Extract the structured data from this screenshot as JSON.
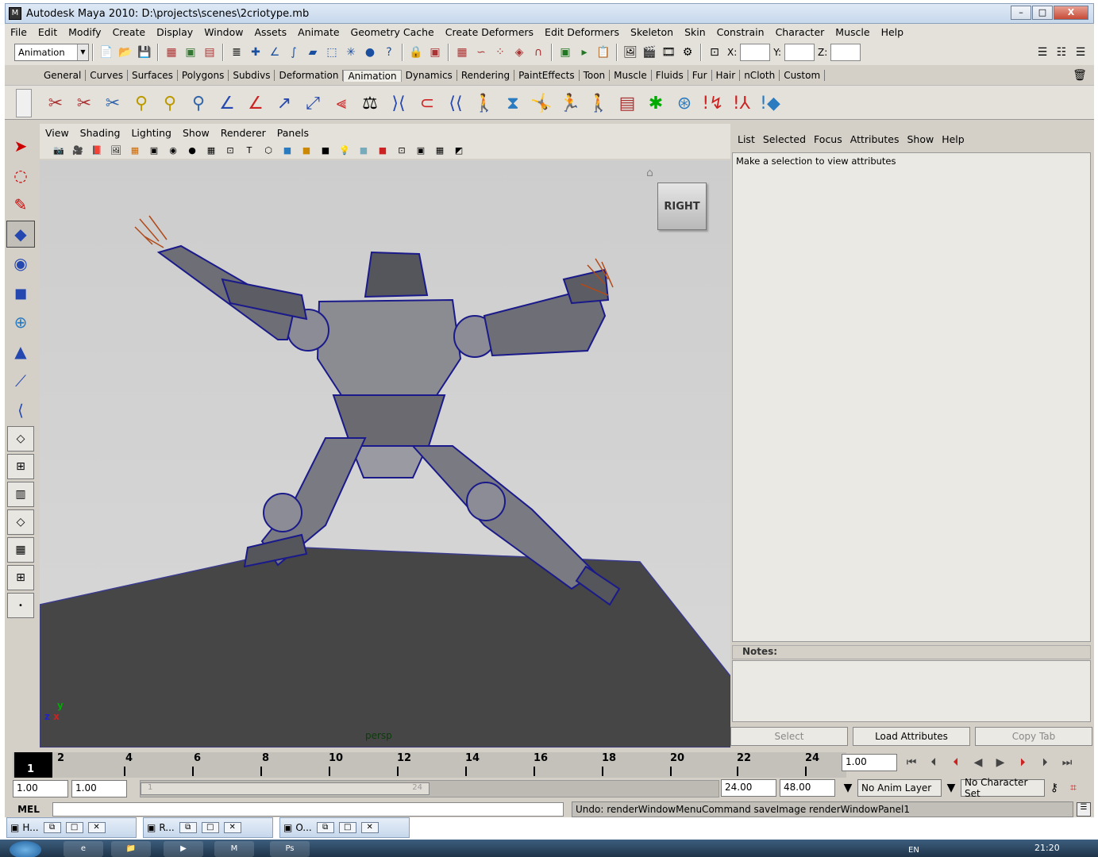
{
  "window": {
    "title": "Autodesk Maya 2010: D:\\projects\\scenes\\2criotype.mb",
    "minimize": "–",
    "maximize": "□",
    "close": "X"
  },
  "menubar": [
    "File",
    "Edit",
    "Modify",
    "Create",
    "Display",
    "Window",
    "Assets",
    "Animate",
    "Geometry Cache",
    "Create Deformers",
    "Edit Deformers",
    "Skeleton",
    "Skin",
    "Constrain",
    "Character",
    "Muscle",
    "Help"
  ],
  "statusline": {
    "menuset": "Animation",
    "x_label": "X:",
    "y_label": "Y:",
    "z_label": "Z:"
  },
  "shelf_tabs": [
    "General",
    "Curves",
    "Surfaces",
    "Polygons",
    "Subdivs",
    "Deformation",
    "Animation",
    "Dynamics",
    "Rendering",
    "PaintEffects",
    "Toon",
    "Muscle",
    "Fluids",
    "Fur",
    "Hair",
    "nCloth",
    "Custom"
  ],
  "active_shelf_tab": "Animation",
  "panel_menu": [
    "View",
    "Shading",
    "Lighting",
    "Show",
    "Renderer",
    "Panels"
  ],
  "viewport": {
    "camera_label": "persp",
    "viewcube_label": "RIGHT",
    "axis_y": "y",
    "axis_z": "z",
    "axis_x": "x"
  },
  "attribute_editor": {
    "menu": [
      "List",
      "Selected",
      "Focus",
      "Attributes",
      "Show",
      "Help"
    ],
    "message": "Make a selection to view attributes",
    "notes_label": "Notes:",
    "buttons": {
      "select": "Select",
      "load": "Load Attributes",
      "copy": "Copy Tab"
    }
  },
  "timeline": {
    "current_frame": "1",
    "ticks": [
      "2",
      "4",
      "6",
      "8",
      "10",
      "12",
      "14",
      "16",
      "18",
      "20",
      "22",
      "24"
    ],
    "current_time_field": "1.00"
  },
  "range": {
    "start_time": "1.00",
    "playback_start": "1.00",
    "playback_end": "24.00",
    "end_time": "48.00",
    "handle_start": "1",
    "handle_end": "24",
    "anim_layer": "No Anim Layer",
    "character_set": "No Character Set"
  },
  "command_line": {
    "label": "MEL",
    "result": "Undo: renderWindowMenuCommand saveImage renderWindowPanel1"
  },
  "minimized_windows": [
    {
      "label": "H..."
    },
    {
      "label": "R..."
    },
    {
      "label": "O..."
    }
  ],
  "taskbar": {
    "language": "EN",
    "clock": "21:20",
    "ps_label": "Ps"
  }
}
